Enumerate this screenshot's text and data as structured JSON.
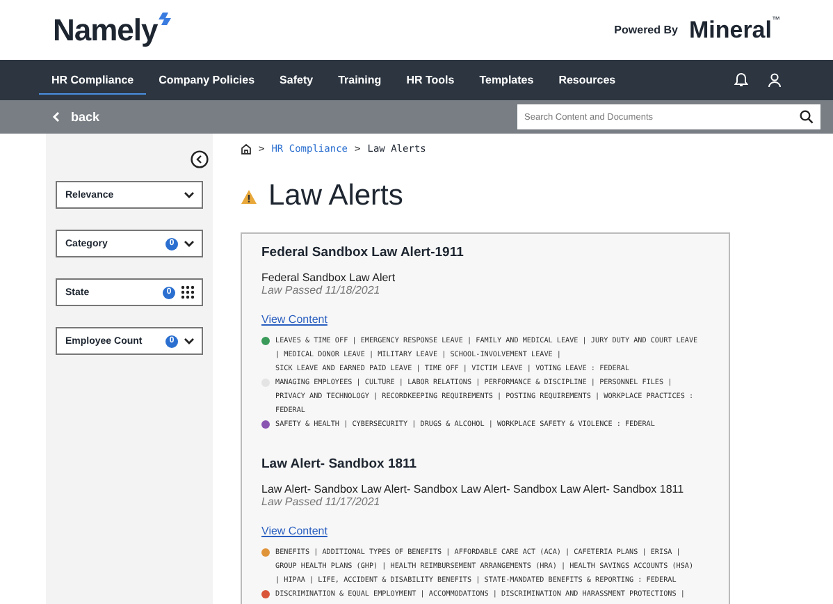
{
  "header": {
    "logo": "Namely",
    "powered_by": "Powered By",
    "partner": "Mineral",
    "partner_mark": "™"
  },
  "nav": {
    "tabs": [
      {
        "label": "HR Compliance",
        "selected": true
      },
      {
        "label": "Company Policies",
        "selected": false
      },
      {
        "label": "Safety",
        "selected": false
      },
      {
        "label": "Training",
        "selected": false
      },
      {
        "label": "HR Tools",
        "selected": false
      },
      {
        "label": "Templates",
        "selected": false
      },
      {
        "label": "Resources",
        "selected": false
      }
    ]
  },
  "subbar": {
    "back": "back",
    "search": {
      "placeholder": "Search Content and Documents"
    }
  },
  "filters": [
    {
      "label": "Relevance",
      "kind": "dropdown"
    },
    {
      "label": "Category",
      "kind": "dropdown",
      "count": "0"
    },
    {
      "label": "State",
      "kind": "grid",
      "count": "0"
    },
    {
      "label": "Employee Count",
      "kind": "dropdown",
      "count": "0"
    }
  ],
  "breadcrumb": {
    "separator_1": ">",
    "link": "HR Compliance",
    "separator_2": ">",
    "current": "Law Alerts"
  },
  "page_title": "Law Alerts",
  "alerts": [
    {
      "title": "Federal Sandbox Law Alert-1911",
      "summary": "Federal Sandbox Law Alert",
      "passed": "Law Passed 11/18/2021",
      "link": "View Content",
      "tag_groups": [
        {
          "color": "#3a9a5a",
          "lines": [
            "LEAVES & TIME OFF | EMERGENCY RESPONSE LEAVE | FAMILY AND MEDICAL LEAVE | JURY DUTY AND COURT LEAVE",
            "| MEDICAL DONOR LEAVE | MILITARY LEAVE | SCHOOL-INVOLVEMENT LEAVE |",
            "SICK LEAVE AND EARNED PAID LEAVE | TIME OFF | VICTIM LEAVE | VOTING LEAVE : FEDERAL"
          ]
        },
        {
          "color": "#e4e4e4",
          "lines": [
            "MANAGING EMPLOYEES | CULTURE | LABOR RELATIONS | PERFORMANCE & DISCIPLINE | PERSONNEL FILES |",
            "PRIVACY AND TECHNOLOGY | RECORDKEEPING REQUIREMENTS | POSTING REQUIREMENTS | WORKPLACE PRACTICES :",
            "FEDERAL"
          ]
        },
        {
          "color": "#8a55b0",
          "lines": [
            "SAFETY & HEALTH | CYBERSECURITY | DRUGS & ALCOHOL | WORKPLACE SAFETY & VIOLENCE : FEDERAL"
          ]
        }
      ]
    },
    {
      "title": "Law Alert- Sandbox 1811",
      "summary": "Law Alert- Sandbox Law Alert- Sandbox Law Alert- Sandbox Law Alert- Sandbox 1811",
      "passed": "Law Passed 11/17/2021",
      "link": "View Content",
      "tag_groups": [
        {
          "color": "#e0943a",
          "lines": [
            "BENEFITS | ADDITIONAL TYPES OF BENEFITS | AFFORDABLE CARE ACT (ACA) | CAFETERIA PLANS | ERISA |",
            "GROUP HEALTH PLANS (GHP) | HEALTH REIMBURSEMENT ARRANGEMENTS (HRA) | HEALTH SAVINGS ACCOUNTS (HSA)",
            "| HIPAA | LIFE, ACCIDENT & DISABILITY BENEFITS | STATE-MANDATED BENEFITS & REPORTING : FEDERAL"
          ]
        },
        {
          "color": "#d9553a",
          "lines": [
            "DISCRIMINATION & EQUAL EMPLOYMENT | ACCOMMODATIONS | DISCRIMINATION AND HARASSMENT PROTECTIONS |"
          ]
        }
      ]
    }
  ]
}
